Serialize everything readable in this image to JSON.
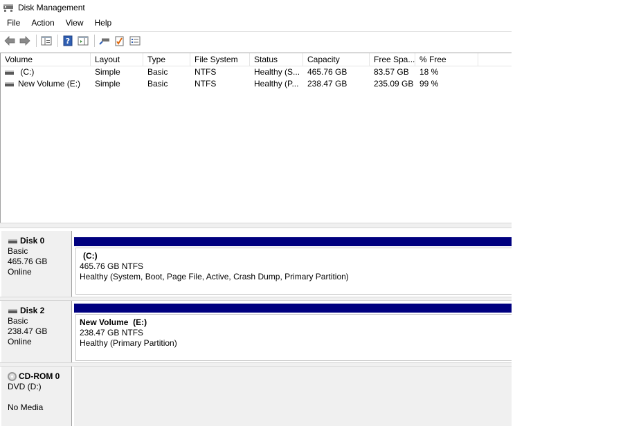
{
  "window": {
    "title": "Disk Management"
  },
  "menu": [
    "File",
    "Action",
    "View",
    "Help"
  ],
  "toolbar": [
    {
      "icon": "back-arrow-icon"
    },
    {
      "icon": "forward-arrow-icon"
    },
    {
      "icon": "show-hide-console-tree-icon"
    },
    {
      "icon": "help-icon"
    },
    {
      "icon": "show-hide-action-pane-icon"
    },
    {
      "icon": "connect-virtual-disk-icon"
    },
    {
      "icon": "checklist-icon"
    },
    {
      "icon": "properties-icon"
    }
  ],
  "volumes": {
    "columns": [
      "Volume",
      "Layout",
      "Type",
      "File System",
      "Status",
      "Capacity",
      "Free Spa...",
      "% Free"
    ],
    "rows": [
      {
        "volume": " (C:)",
        "layout": "Simple",
        "type": "Basic",
        "fs": "NTFS",
        "status": "Healthy (S...",
        "capacity": "465.76 GB",
        "free": "83.57 GB",
        "pct": "18 %"
      },
      {
        "volume": "New Volume (E:)",
        "layout": "Simple",
        "type": "Basic",
        "fs": "NTFS",
        "status": "Healthy (P...",
        "capacity": "238.47 GB",
        "free": "235.09 GB",
        "pct": "99 %"
      }
    ]
  },
  "disks": [
    {
      "name": "Disk 0",
      "type": "Basic",
      "size": "465.76 GB",
      "state": "Online",
      "partition": {
        "name": "(C:)",
        "size_fs": "465.76 GB NTFS",
        "status": "Healthy (System, Boot, Page File, Active, Crash Dump, Primary Partition)"
      }
    },
    {
      "name": "Disk 2",
      "type": "Basic",
      "size": "238.47 GB",
      "state": "Online",
      "partition": {
        "name": "New Volume  (E:)",
        "size_fs": "238.47 GB NTFS",
        "status": "Healthy (Primary Partition)"
      }
    },
    {
      "name": "CD-ROM 0",
      "type": "DVD (D:)",
      "size": "",
      "state": "No Media"
    }
  ],
  "colors": {
    "partition_bar": "#00007f",
    "pane_bg": "#f0f0f0"
  }
}
